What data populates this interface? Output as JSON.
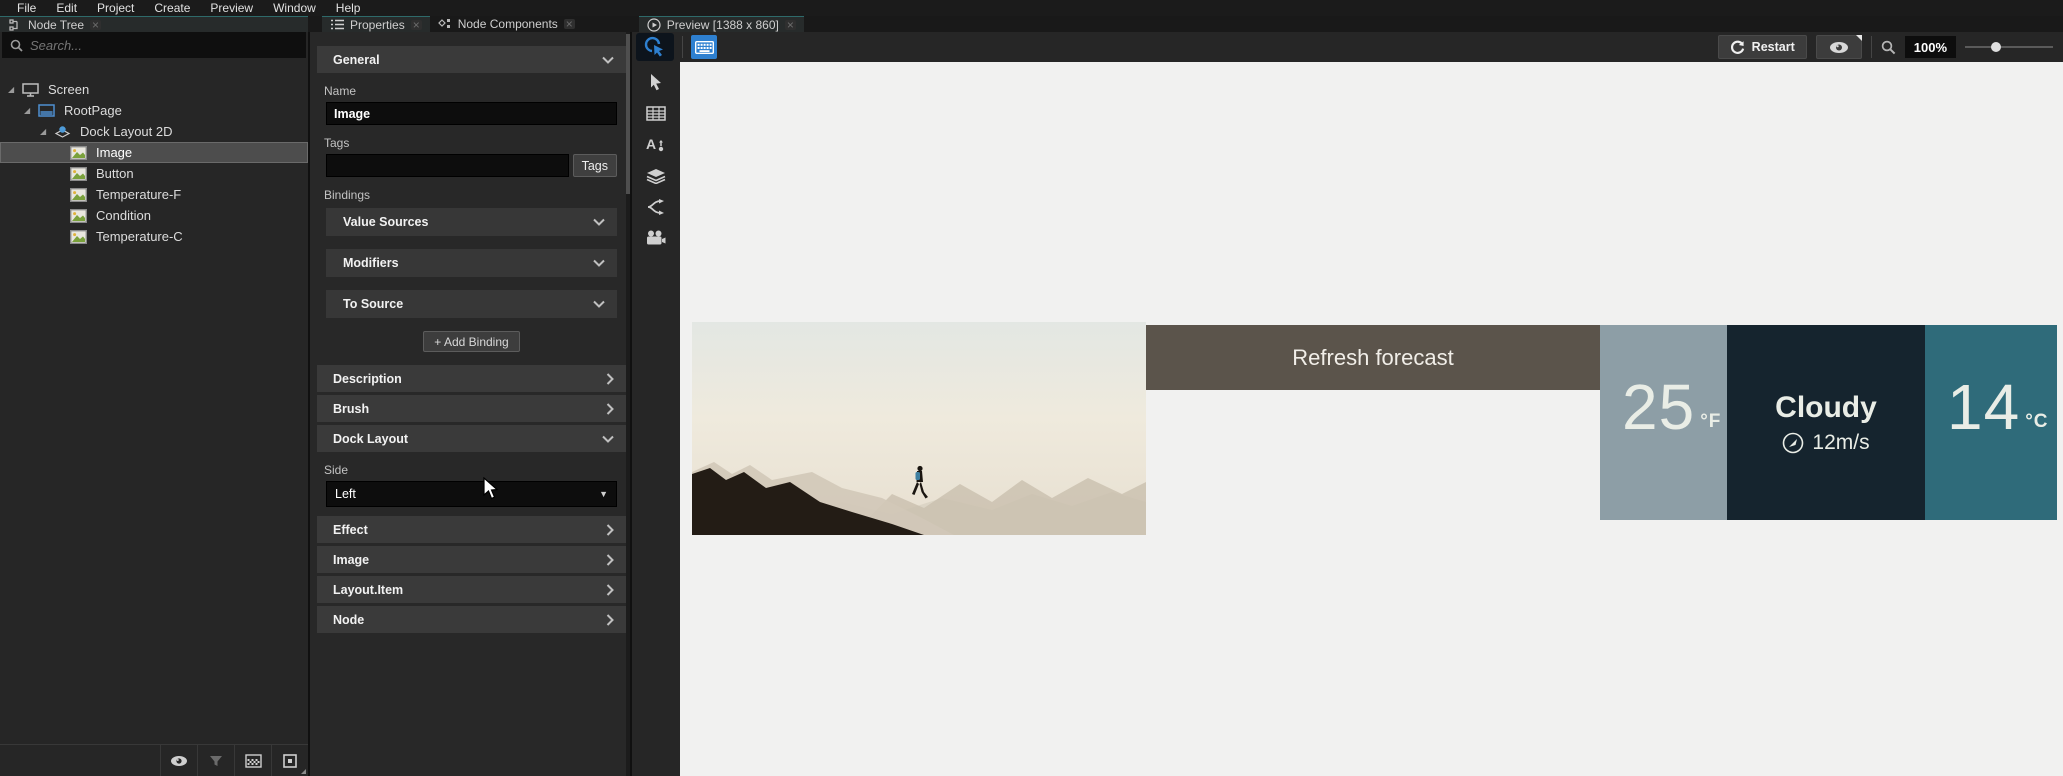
{
  "menu": {
    "items": [
      "File",
      "Edit",
      "Project",
      "Create",
      "Preview",
      "Window",
      "Help"
    ]
  },
  "node_tree": {
    "tab_label": "Node Tree",
    "close_label": "×",
    "search_placeholder": "Search...",
    "items": [
      {
        "label": "Screen"
      },
      {
        "label": "RootPage"
      },
      {
        "label": "Dock Layout 2D"
      },
      {
        "label": "Image"
      },
      {
        "label": "Button"
      },
      {
        "label": "Temperature-F"
      },
      {
        "label": "Condition"
      },
      {
        "label": "Temperature-C"
      }
    ]
  },
  "properties": {
    "tab_label": "Properties",
    "components_tab_label": "Node Components",
    "close_label": "×",
    "general_header": "General",
    "name_label": "Name",
    "name_value": "Image",
    "tags_label": "Tags",
    "tags_button": "Tags",
    "bindings_label": "Bindings",
    "value_sources_header": "Value Sources",
    "modifiers_header": "Modifiers",
    "to_source_header": "To Source",
    "add_binding_button": "+ Add Binding",
    "description_header": "Description",
    "brush_header": "Brush",
    "dock_layout_header": "Dock Layout",
    "side_label": "Side",
    "side_value": "Left",
    "effect_header": "Effect",
    "image_header": "Image",
    "layout_item_header": "Layout.Item",
    "node_header": "Node"
  },
  "preview": {
    "tab_label": "Preview [1388 x 860]",
    "close_label": "×",
    "restart_button": "Restart",
    "zoom_value": "100%",
    "weather_app": {
      "refresh_button": "Refresh forecast",
      "temp_f_value": "25",
      "temp_f_unit": "°F",
      "condition": "Cloudy",
      "wind_speed": "12m/s",
      "temp_c_value": "14",
      "temp_c_unit": "°C"
    }
  },
  "colors": {
    "accent_blue": "#2e80d0",
    "refresh_bar": "#5b544b",
    "panel_fahrenheit": "#8d9ea6",
    "panel_condition": "#15242e",
    "panel_celsius": "#2f6b7a",
    "canvas_background": "#f1f1f0",
    "ui_background": "#262626"
  }
}
